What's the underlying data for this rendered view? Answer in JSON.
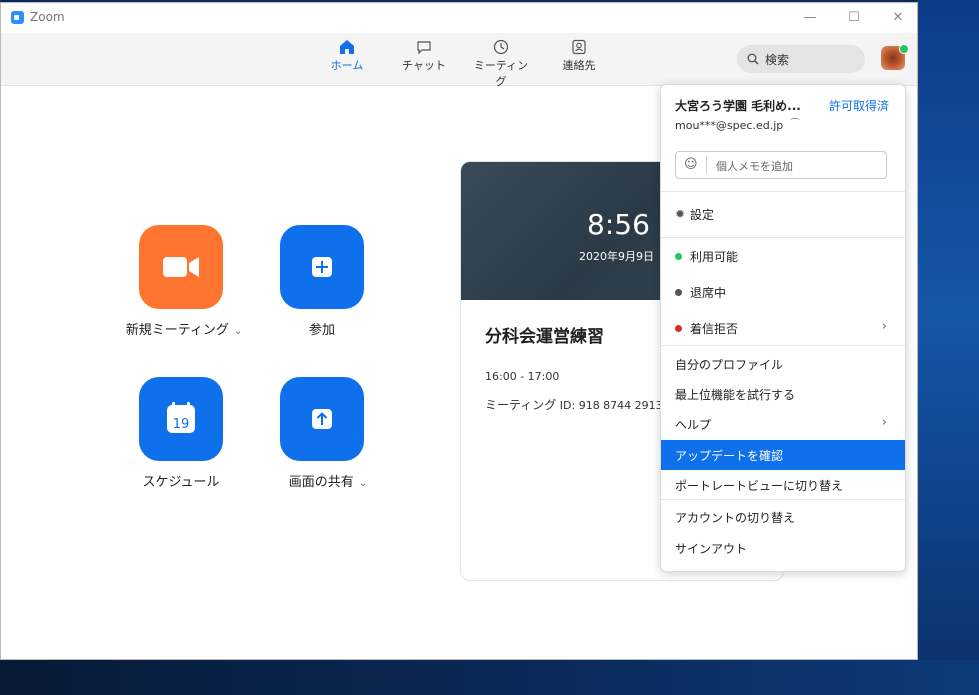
{
  "window": {
    "title": "Zoom",
    "minimize": "—",
    "maximize": "☐",
    "close": "✕"
  },
  "nav": {
    "home": "ホーム",
    "chat": "チャット",
    "meetings": "ミーティング",
    "contacts": "連絡先"
  },
  "search": {
    "label": "検索"
  },
  "actions": {
    "new_meeting": "新規ミーティング",
    "join": "参加",
    "schedule": "スケジュール",
    "schedule_day": "19",
    "share_screen": "画面の共有"
  },
  "card": {
    "time": "8:56",
    "date": "2020年9月9日",
    "title": "分科会運営練習",
    "time_range": "16:00 - 17:00",
    "meeting_id_label": "ミーティング",
    "meeting_id": " ID: 918 8744 2913"
  },
  "menu": {
    "name": "大宮ろう学園 毛利め...",
    "license": "許可取得済",
    "email": "mou***@spec.ed.jp",
    "memo_placeholder": "個人メモを追加",
    "settings": "設定",
    "available": "利用可能",
    "away": "退席中",
    "dnd": "着信拒否",
    "profile": "自分のプロファイル",
    "try_top": "最上位機能を試行する",
    "help": "ヘルプ",
    "check_updates": "アップデートを確認",
    "portrait": "ポートレートビューに切り替え",
    "switch_account": "アカウントの切り替え",
    "sign_out": "サインアウト"
  },
  "colors": {
    "accent": "#0e71eb",
    "orange": "#ff742e",
    "available": "#22c55e",
    "away": "#555555",
    "dnd": "#e02828"
  }
}
